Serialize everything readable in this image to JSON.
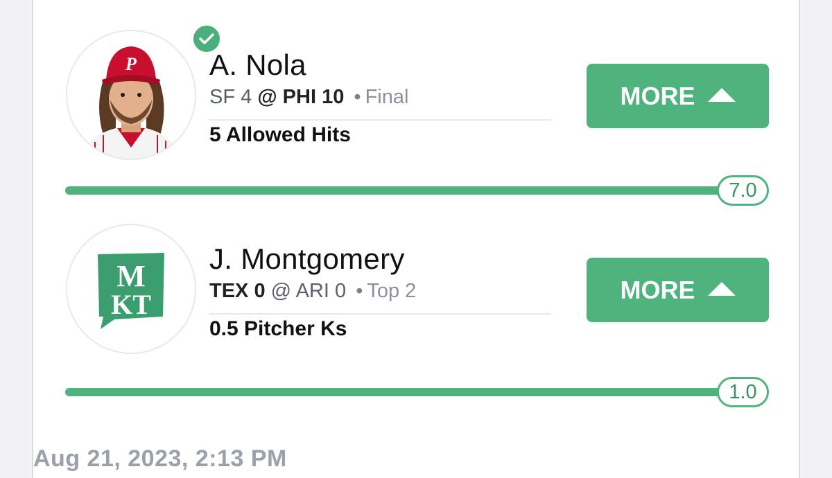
{
  "picks": [
    {
      "player": "A. Nola",
      "avatar_icon": "player-headshot",
      "completed": true,
      "away_team": "SF",
      "away_score": "4",
      "at": "@",
      "home_team": "PHI",
      "home_score": "10",
      "status": "Final",
      "stat": "5 Allowed Hits",
      "more_label": "MORE",
      "current_value": "7.0",
      "progress": 1.0
    },
    {
      "player": "J. Montgomery",
      "avatar_icon": "mkt-logo",
      "avatar_logo_text": [
        "M",
        "KT"
      ],
      "completed": false,
      "away_team": "TEX",
      "away_score": "0",
      "at": "@",
      "home_team": "ARI",
      "home_score": "0",
      "status": "Top 2",
      "stat": "0.5 Pitcher Ks",
      "more_label": "MORE",
      "current_value": "1.0",
      "progress": 1.0
    }
  ],
  "timestamp": "Aug 21, 2023, 2:13 PM",
  "colors": {
    "accent_green": "#4fb37e",
    "check_green": "#4caf7b",
    "logo_green": "#3a9e6e"
  }
}
